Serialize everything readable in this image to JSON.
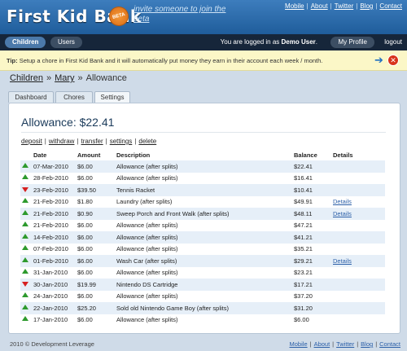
{
  "header": {
    "logo": "First Kid Bank",
    "beta": "BETA",
    "invite": "invite someone to join the beta",
    "links": [
      "Mobile",
      "About",
      "Twitter",
      "Blog",
      "Contact"
    ]
  },
  "nav": {
    "children": "Children",
    "users": "Users",
    "logged_prefix": "You are logged in as ",
    "user": "Demo User",
    "logged_suffix": ".",
    "profile": "My Profile",
    "logout": "logout"
  },
  "tip": {
    "label": "Tip:",
    "text": " Setup a chore in First Kid Bank and it will automatically put money they earn in their account each week / month."
  },
  "breadcrumb": {
    "root": "Children",
    "child": "Mary",
    "current": "Allowance"
  },
  "tabs": [
    "Dashboard",
    "Chores",
    "Settings"
  ],
  "panel": {
    "title": "Allowance: $22.41",
    "actions": [
      "deposit",
      "withdraw",
      "transfer",
      "settings",
      "delete"
    ]
  },
  "table": {
    "headers": [
      "Date",
      "Amount",
      "Description",
      "Balance",
      "Details"
    ],
    "rows": [
      {
        "dir": "up",
        "date": "07-Mar-2010",
        "amount": "$6.00",
        "desc": "Allowance (after splits)",
        "balance": "$22.41",
        "details": ""
      },
      {
        "dir": "up",
        "date": "28-Feb-2010",
        "amount": "$6.00",
        "desc": "Allowance (after splits)",
        "balance": "$16.41",
        "details": ""
      },
      {
        "dir": "down",
        "date": "23-Feb-2010",
        "amount": "$39.50",
        "desc": "Tennis Racket",
        "balance": "$10.41",
        "details": ""
      },
      {
        "dir": "up",
        "date": "21-Feb-2010",
        "amount": "$1.80",
        "desc": "Laundry (after splits)",
        "balance": "$49.91",
        "details": "Details"
      },
      {
        "dir": "up",
        "date": "21-Feb-2010",
        "amount": "$0.90",
        "desc": "Sweep Porch and Front Walk (after splits)",
        "balance": "$48.11",
        "details": "Details"
      },
      {
        "dir": "up",
        "date": "21-Feb-2010",
        "amount": "$6.00",
        "desc": "Allowance (after splits)",
        "balance": "$47.21",
        "details": ""
      },
      {
        "dir": "up",
        "date": "14-Feb-2010",
        "amount": "$6.00",
        "desc": "Allowance (after splits)",
        "balance": "$41.21",
        "details": ""
      },
      {
        "dir": "up",
        "date": "07-Feb-2010",
        "amount": "$6.00",
        "desc": "Allowance (after splits)",
        "balance": "$35.21",
        "details": ""
      },
      {
        "dir": "up",
        "date": "01-Feb-2010",
        "amount": "$6.00",
        "desc": "Wash Car (after splits)",
        "balance": "$29.21",
        "details": "Details"
      },
      {
        "dir": "up",
        "date": "31-Jan-2010",
        "amount": "$6.00",
        "desc": "Allowance (after splits)",
        "balance": "$23.21",
        "details": ""
      },
      {
        "dir": "down",
        "date": "30-Jan-2010",
        "amount": "$19.99",
        "desc": "Nintendo DS Cartridge",
        "balance": "$17.21",
        "details": ""
      },
      {
        "dir": "up",
        "date": "24-Jan-2010",
        "amount": "$6.00",
        "desc": "Allowance (after splits)",
        "balance": "$37.20",
        "details": ""
      },
      {
        "dir": "up",
        "date": "22-Jan-2010",
        "amount": "$25.20",
        "desc": "Sold old Nintendo Game Boy (after splits)",
        "balance": "$31.20",
        "details": ""
      },
      {
        "dir": "up",
        "date": "17-Jan-2010",
        "amount": "$6.00",
        "desc": "Allowance (after splits)",
        "balance": "$6.00",
        "details": ""
      }
    ]
  },
  "footer": {
    "copyright": "2010 © Development Leverage",
    "links": [
      "Mobile",
      "About",
      "Twitter",
      "Blog",
      "Contact"
    ]
  }
}
